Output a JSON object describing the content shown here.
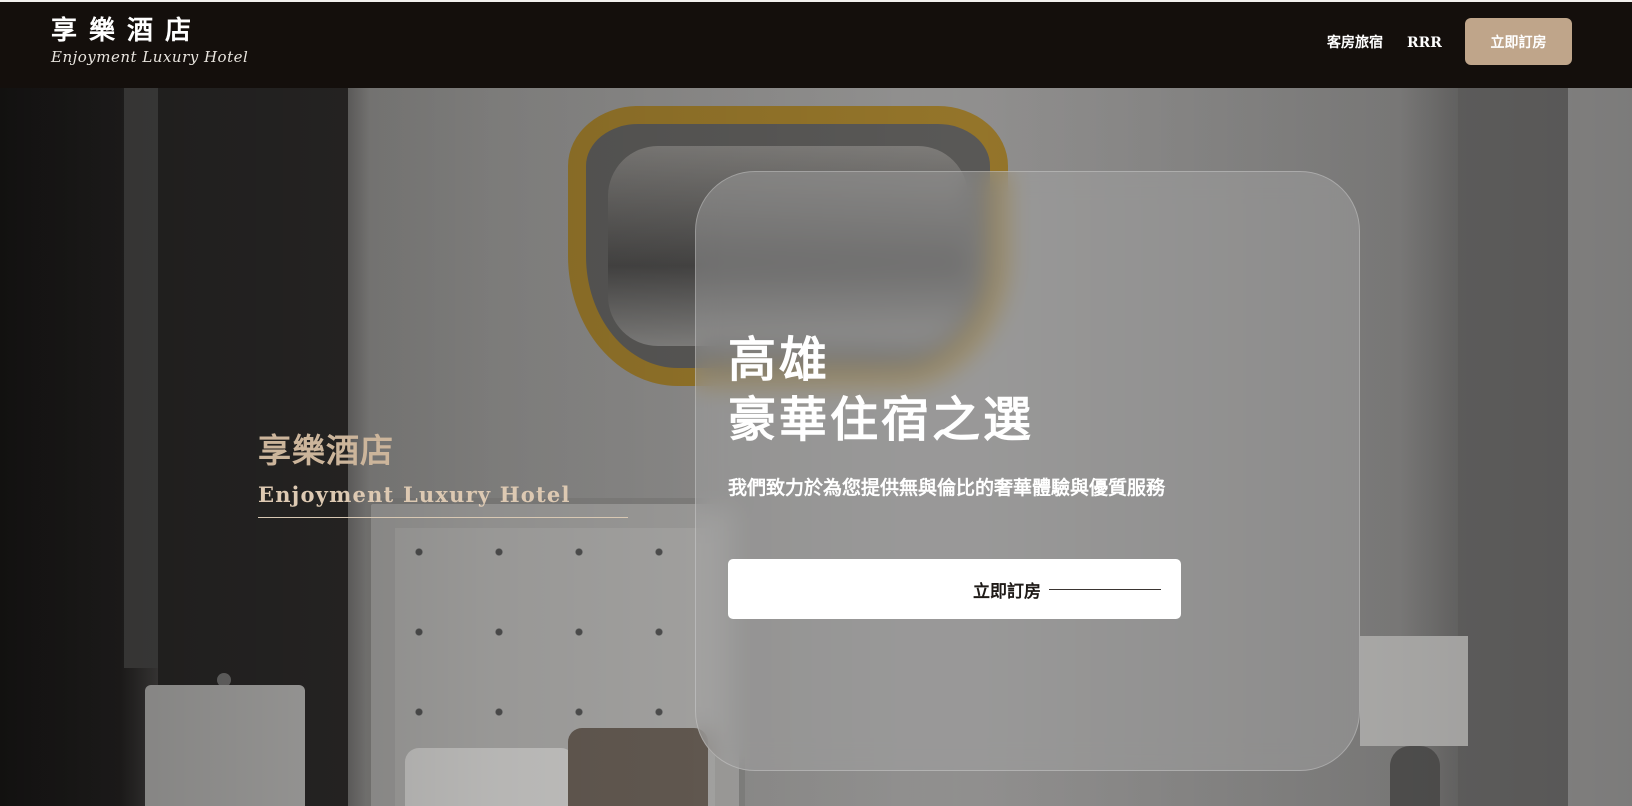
{
  "nav": {
    "brand_cn": "享樂酒店",
    "brand_en": "Enjoyment Luxury Hotel",
    "links": [
      {
        "label": "客房旅宿"
      },
      {
        "label": "RRR"
      }
    ],
    "book_label": "立即訂房"
  },
  "hero": {
    "side_cn": "享樂酒店",
    "side_en": "Enjoyment Luxury Hotel",
    "title_line1": "高雄",
    "title_line2": "豪華住宿之選",
    "subtitle": "我們致力於為您提供無與倫比的奢華體驗與優質服務",
    "cta_label": "立即訂房"
  }
}
